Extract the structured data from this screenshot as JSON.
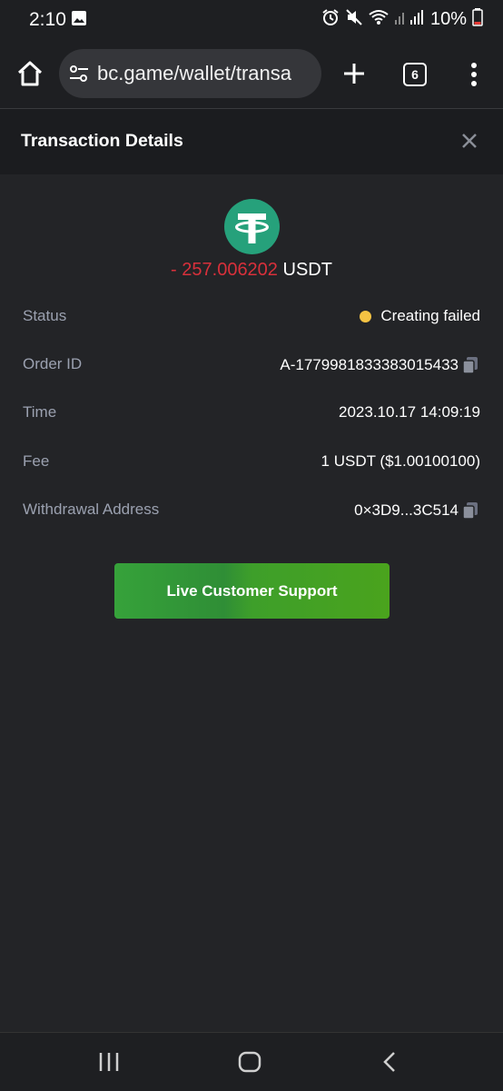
{
  "status_bar": {
    "time": "2:10",
    "battery_percent": "10%"
  },
  "browser": {
    "url": "bc.game/wallet/transa",
    "tab_count": "6"
  },
  "modal": {
    "title": "Transaction Details"
  },
  "transaction": {
    "amount_sign": "- ",
    "amount_value": "257.006202",
    "currency": "USDT",
    "coin_icon": "tether-icon",
    "rows": [
      {
        "label": "Status",
        "value": "Creating failed"
      },
      {
        "label": "Order ID",
        "value": "A-1779981833383015433"
      },
      {
        "label": "Time",
        "value": "2023.10.17 14:09:19"
      },
      {
        "label": "Fee",
        "value": "1 USDT ($1.00100100)"
      },
      {
        "label": "Withdrawal Address",
        "value": "0×3D9...3C514"
      }
    ]
  },
  "support_button_label": "Live Customer Support",
  "colors": {
    "negative": "#d8303b",
    "status_dot": "#f5c343",
    "tether": "#26a17b",
    "button": "#3e9f2a"
  }
}
